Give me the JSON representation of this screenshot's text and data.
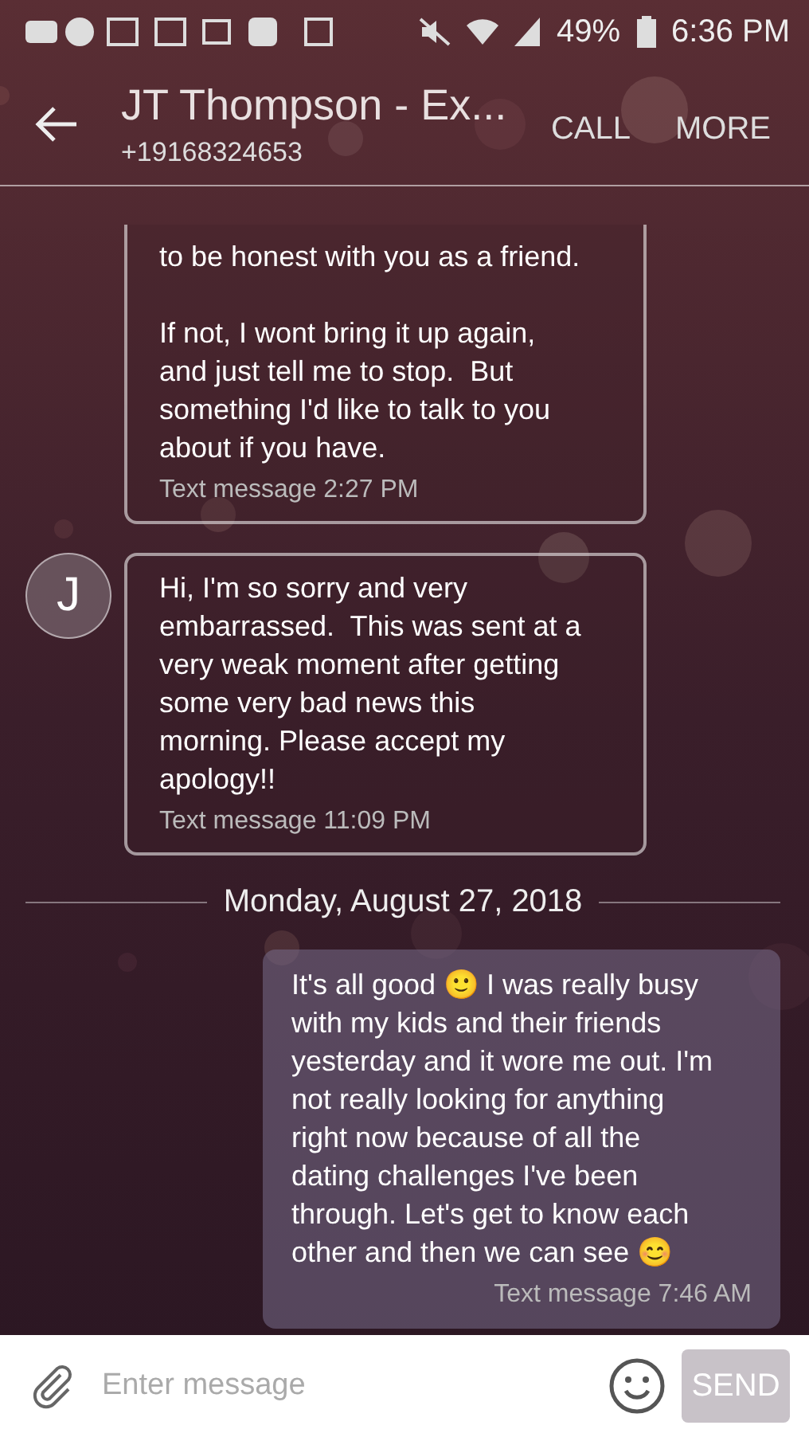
{
  "status_bar": {
    "battery": "49%",
    "time": "6:36 PM"
  },
  "header": {
    "title": "JT Thompson - Ex...",
    "subtitle": "+19168324653",
    "actions": [
      "CALL",
      "MORE"
    ]
  },
  "messages": [
    {
      "kind": "incoming",
      "continued": true,
      "paragraphs": [
        [
          "to be honest with you as a friend."
        ],
        [
          "If not, I wont bring it up again,",
          "and just tell me to stop.  But",
          "something I'd like to talk to you",
          "about if you have."
        ]
      ],
      "meta": "Text message 2:27 PM"
    },
    {
      "kind": "incoming",
      "continued": false,
      "avatar": "J",
      "paragraphs": [
        [
          "Hi, I'm so sorry and very",
          "embarrassed.  This was sent at a",
          "very weak moment after getting",
          "some very bad news this",
          "morning. Please accept my",
          "apology!!"
        ]
      ],
      "meta": "Text message 11:09 PM"
    },
    {
      "kind": "date",
      "text": "Monday, August 27, 2018"
    },
    {
      "kind": "outgoing",
      "paragraphs": [
        [
          "It's all good 🙂 I was really busy",
          "with my kids and their friends",
          "yesterday and it wore me out. I'm",
          "not really looking for anything",
          "right now because of all the",
          "dating challenges I've been",
          "through. Let's get to know each",
          "other and then we can see 😊"
        ]
      ],
      "meta": "Text message 7:46 AM"
    }
  ],
  "composer": {
    "placeholder": "Enter message",
    "send": "SEND",
    "send_disabled": true
  }
}
